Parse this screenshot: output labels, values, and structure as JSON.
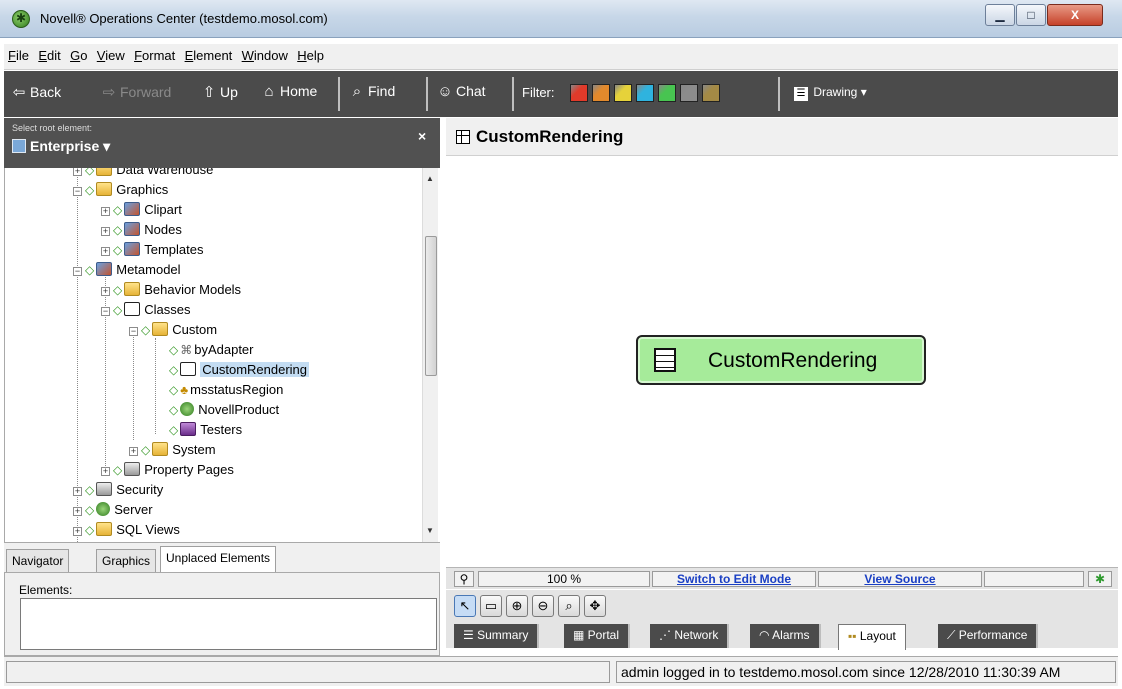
{
  "window": {
    "title": "Novell® Operations Center (testdemo.mosol.com)",
    "minimize": "▁",
    "maximize": "□",
    "close": "X"
  },
  "menu": [
    "File",
    "Edit",
    "Go",
    "View",
    "Format",
    "Element",
    "Window",
    "Help"
  ],
  "toolbar": {
    "back": "Back",
    "forward": "Forward",
    "up": "Up",
    "home": "Home",
    "find": "Find",
    "chat": "Chat",
    "filter": "Filter:",
    "drawing": "Drawing ▾",
    "filter_colors": [
      "#e03a2a",
      "#e2892c",
      "#e6d23a",
      "#2fb3de",
      "#48c451",
      "#8c8c8c",
      "#a48a45"
    ]
  },
  "left_panel": {
    "select_root_label": "Select root element:",
    "root": "Enterprise ▾",
    "close": "×"
  },
  "tree": [
    {
      "label": "Data Warehouse",
      "icon": "folder-icon"
    },
    {
      "label": "Graphics",
      "icon": "folder-icon"
    },
    {
      "label": "Clipart",
      "icon": "globe-icon"
    },
    {
      "label": "Nodes",
      "icon": "globe-icon"
    },
    {
      "label": "Templates",
      "icon": "globe-icon"
    },
    {
      "label": "Metamodel",
      "icon": "globe-icon"
    },
    {
      "label": "Behavior Models",
      "icon": "folder-icon"
    },
    {
      "label": "Classes",
      "icon": "cube-icon"
    },
    {
      "label": "Custom",
      "icon": "folder-icon"
    },
    {
      "label": "byAdapter",
      "icon": "adapter-icon"
    },
    {
      "label": "CustomRendering",
      "icon": "cube-icon"
    },
    {
      "label": "msstatusRegion",
      "icon": "region-icon"
    },
    {
      "label": "NovellProduct",
      "icon": "novell-icon"
    },
    {
      "label": "Testers",
      "icon": "testers-icon"
    },
    {
      "label": "System",
      "icon": "folder-icon"
    },
    {
      "label": "Property Pages",
      "icon": "page-icon"
    },
    {
      "label": "Security",
      "icon": "lock-icon"
    },
    {
      "label": "Server",
      "icon": "novell-icon"
    },
    {
      "label": "SQL Views",
      "icon": "folder-icon"
    }
  ],
  "left_tabs": [
    "Navigator",
    "Graphics",
    "Unplaced Elements"
  ],
  "elements_label": "Elements:",
  "right_panel": {
    "title": "CustomRendering",
    "node_label": "CustomRendering"
  },
  "view_status": {
    "zoom": "100 %",
    "switch_mode": "Switch to Edit Mode",
    "view_source": "View Source"
  },
  "right_tabs": [
    "Summary",
    "Portal",
    "Network",
    "Alarms",
    "Layout",
    "Performance"
  ],
  "status": {
    "text": "admin logged in to testdemo.mosol.com since 12/28/2010 11:30:39 AM"
  }
}
